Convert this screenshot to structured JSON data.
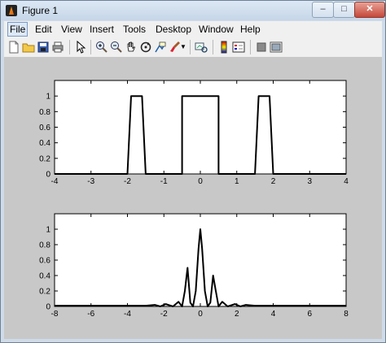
{
  "window": {
    "title": "Figure 1"
  },
  "menu": [
    "File",
    "Edit",
    "View",
    "Insert",
    "Tools",
    "Desktop",
    "Window",
    "Help"
  ],
  "toolbar": {
    "icons": [
      "new-file-icon",
      "open-folder-icon",
      "save-icon",
      "print-icon",
      "pointer-icon",
      "zoom-in-icon",
      "zoom-out-icon",
      "pan-hand-icon",
      "rotate-3d-icon",
      "data-cursor-icon",
      "brush-icon",
      "link-plot-icon",
      "colorbar-icon",
      "legend-icon",
      "hide-plot-tools-icon",
      "show-plot-tools-icon"
    ]
  },
  "chart_data": [
    {
      "type": "line",
      "title": "",
      "xlabel": "",
      "ylabel": "",
      "xlim": [
        -4,
        4
      ],
      "ylim": [
        0,
        1.2
      ],
      "xticks": [
        "-4",
        "-3",
        "-2",
        "-1",
        "0",
        "1",
        "2",
        "3",
        "4"
      ],
      "yticks": [
        "0",
        "0.2",
        "0.4",
        "0.6",
        "0.8",
        "1"
      ],
      "series": [
        {
          "x": [
            -4,
            -2,
            -1.9,
            -1.6,
            -1.5,
            -0.5,
            -0.5,
            0.5,
            0.5,
            1.5,
            1.6,
            1.9,
            2,
            4
          ],
          "y": [
            0,
            0,
            1,
            1,
            0,
            0,
            1,
            1,
            0,
            0,
            1,
            1,
            0,
            0
          ]
        }
      ]
    },
    {
      "type": "line",
      "title": "",
      "xlabel": "",
      "ylabel": "",
      "xlim": [
        -8,
        8
      ],
      "ylim": [
        0,
        1.2
      ],
      "xticks": [
        "-8",
        "-6",
        "-4",
        "-2",
        "0",
        "2",
        "4",
        "6",
        "8"
      ],
      "yticks": [
        "0",
        "0.2",
        "0.4",
        "0.6",
        "0.8",
        "1"
      ],
      "series": [
        {
          "x": [
            -8,
            -3,
            -2.5,
            -2.2,
            -1.9,
            -1.5,
            -1.2,
            -1.0,
            -0.85,
            -0.7,
            -0.55,
            -0.4,
            -0.25,
            -0.1,
            0,
            0.1,
            0.25,
            0.4,
            0.55,
            0.7,
            0.85,
            1.0,
            1.2,
            1.5,
            1.9,
            2.2,
            2.5,
            3,
            8
          ],
          "y": [
            0.01,
            0.01,
            0.02,
            0.0,
            0.03,
            0.0,
            0.06,
            0.0,
            0.2,
            0.5,
            0.05,
            0.0,
            0.2,
            0.75,
            1.0,
            0.75,
            0.2,
            0.0,
            0.05,
            0.4,
            0.2,
            0.0,
            0.06,
            0.0,
            0.03,
            0.0,
            0.02,
            0.01,
            0.01
          ]
        }
      ]
    }
  ]
}
